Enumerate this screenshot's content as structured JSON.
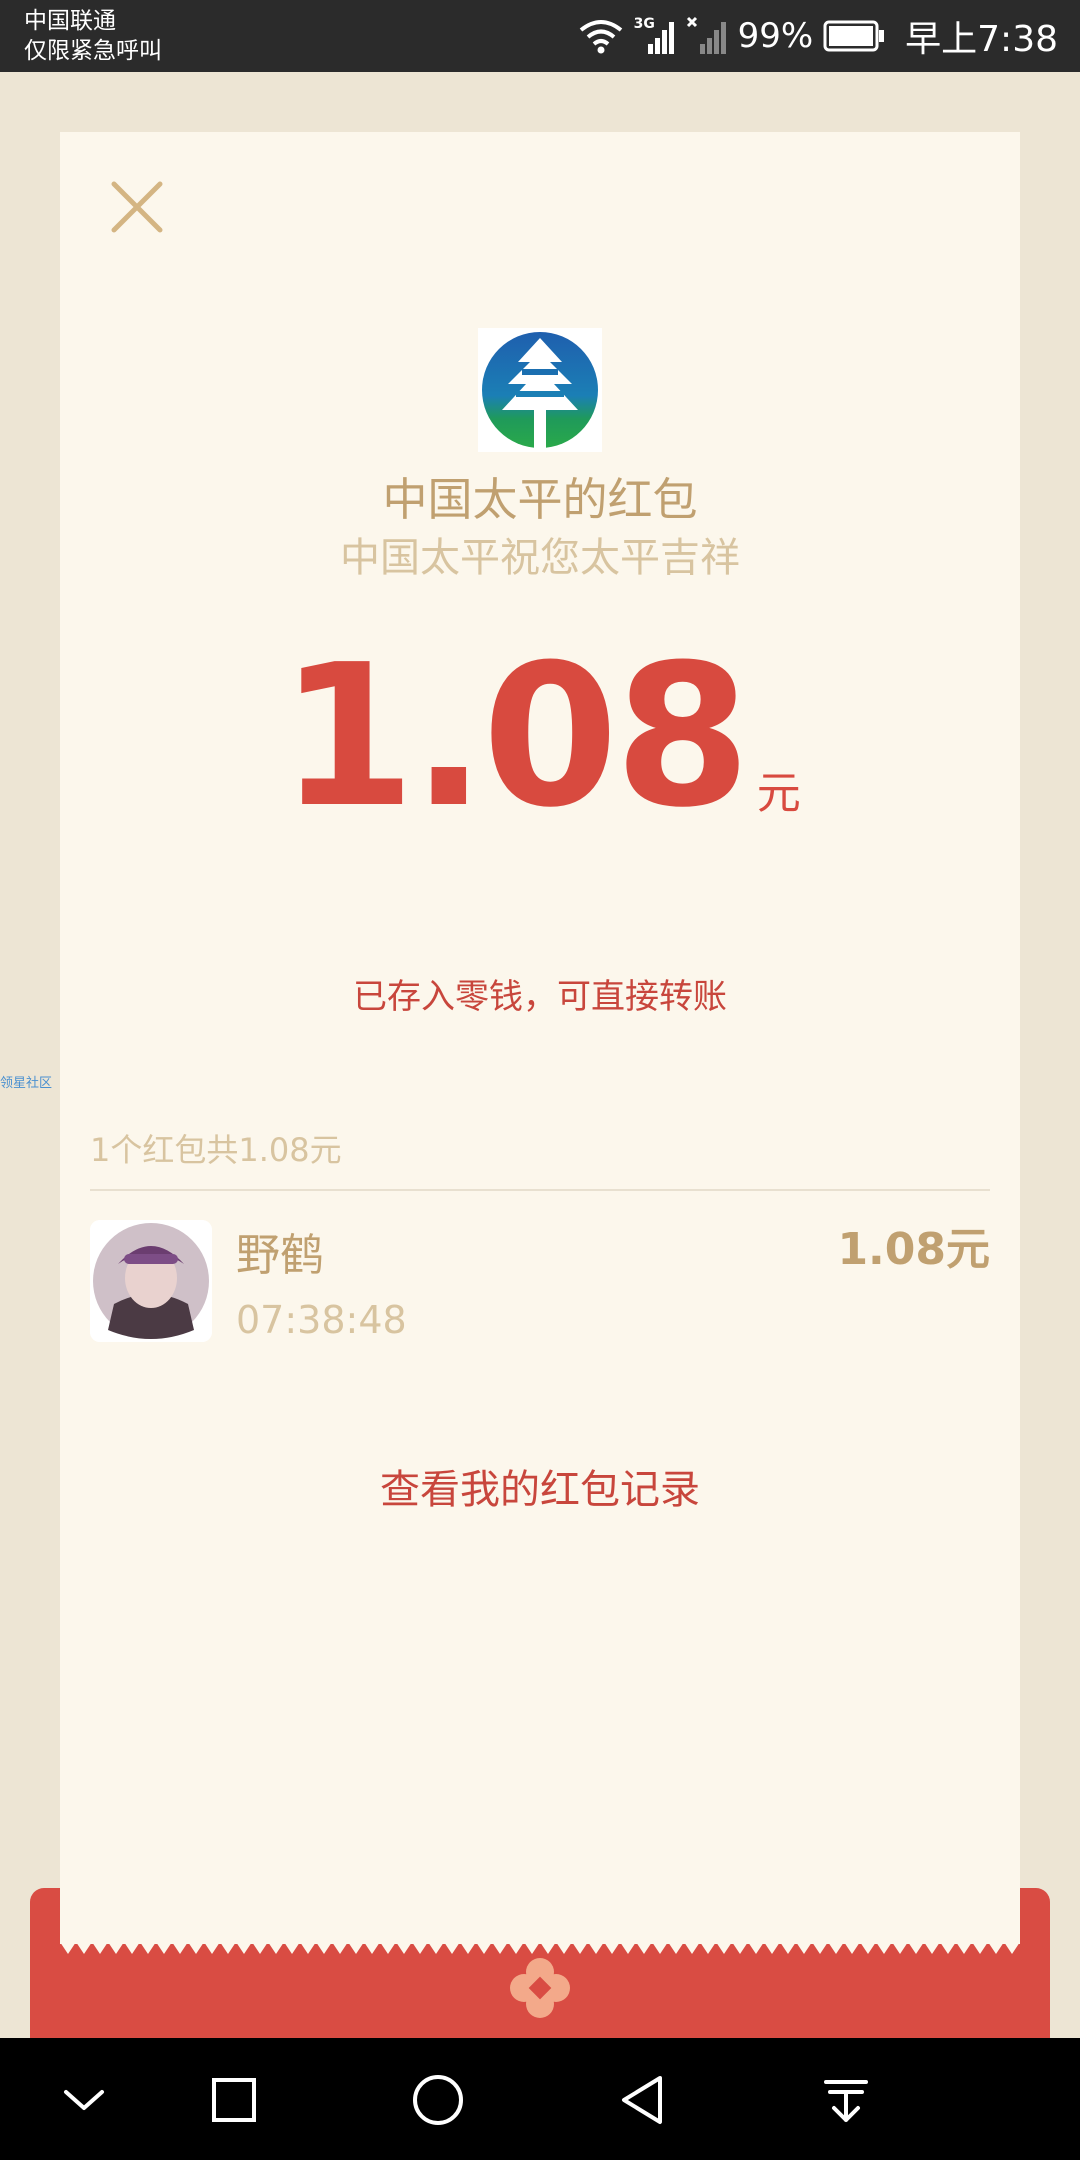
{
  "status_bar": {
    "carrier": "中国联通",
    "emergency": "仅限紧急呼叫",
    "network_type": "3G",
    "battery_percent": "99%",
    "time": "早上7:38"
  },
  "card": {
    "brand_title": "中国太平的红包",
    "brand_subtitle": "中国太平祝您太平吉祥",
    "amount": "1.08",
    "amount_unit": "元",
    "saved_note": "已存入零钱，可直接转账",
    "summary": "1个红包共1.08元",
    "side_watermark": "领星社区",
    "record": {
      "name": "野鹤",
      "time": "07:38:48",
      "amount": "1.08元"
    },
    "history_link": "查看我的红包记录"
  },
  "colors": {
    "amount_red": "#d84a3f",
    "gold": "#c0a070",
    "envelope_red": "#d94c43",
    "card_bg": "#fcf7ec",
    "page_bg": "#ede5d4"
  },
  "icons": {
    "close": "close-icon",
    "logo": "pine-tree-logo-icon",
    "nav": [
      "chevron-down-icon",
      "square-recents-icon",
      "circle-home-icon",
      "triangle-back-icon",
      "download-icon"
    ]
  }
}
